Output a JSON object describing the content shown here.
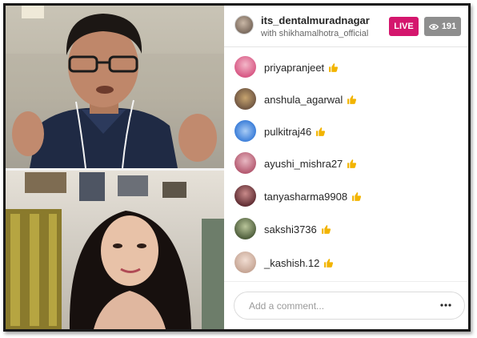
{
  "header": {
    "host_username": "its_dentalmuradnagar",
    "host_subtitle": "with shikhamalhotra_official",
    "live_label": "LIVE",
    "viewer_count": "191"
  },
  "comments": [
    {
      "username": "priyapranjeet",
      "avatar_color": "#d85a86"
    },
    {
      "username": "anshula_agarwal",
      "avatar_color": "#6b5240"
    },
    {
      "username": "pulkitraj46",
      "avatar_color": "#3d7fd9"
    },
    {
      "username": "ayushi_mishra27",
      "avatar_color": "#b2566d"
    },
    {
      "username": "tanyasharma9908",
      "avatar_color": "#5c2a30"
    },
    {
      "username": "sakshi3736",
      "avatar_color": "#4a5a38"
    },
    {
      "username": "_kashish.12",
      "avatar_color": "#c4a392"
    }
  ],
  "comment_box": {
    "placeholder": "Add a comment..."
  },
  "colors": {
    "live": "#d4166d",
    "viewer_badge": "#8e8e8e",
    "thumb": "#f2b400"
  },
  "icons": {
    "viewers": "eye-icon",
    "reaction": "thumbs-up-icon",
    "more": "more-options-icon"
  }
}
